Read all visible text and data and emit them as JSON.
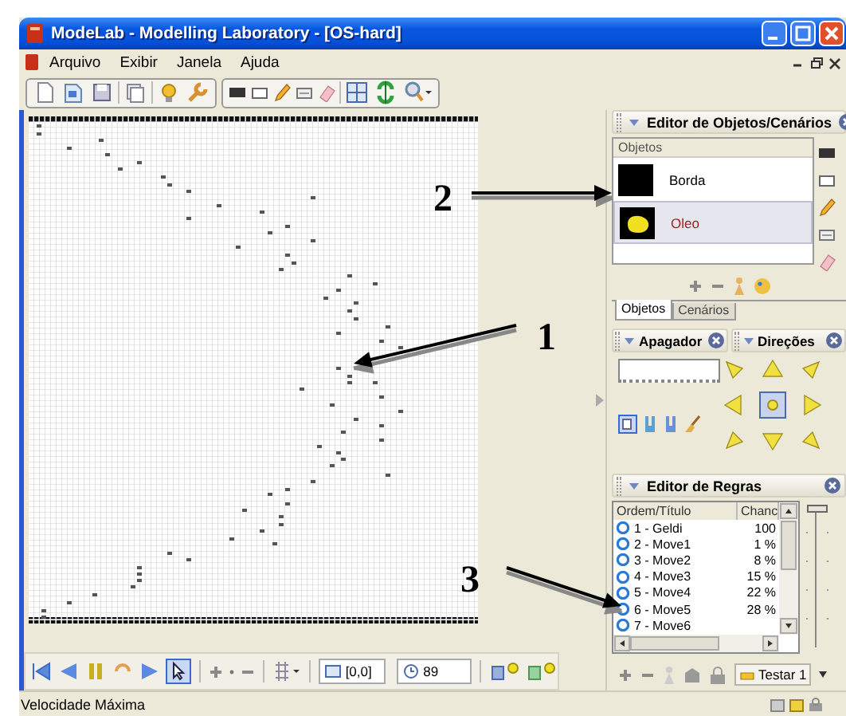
{
  "window": {
    "title": "ModeLab - Modelling Laboratory - [OS-hard]"
  },
  "menu": [
    {
      "label": "Arquivo"
    },
    {
      "label": "Exibir"
    },
    {
      "label": "Janela"
    },
    {
      "label": "Ajuda"
    }
  ],
  "objects_panel": {
    "title": "Editor de Objetos/Cenários",
    "column": "Objetos",
    "items": [
      {
        "name": "Borda",
        "color": "#000000",
        "selected": false
      },
      {
        "name": "Oleo",
        "color": "#f0e020",
        "selected": true
      }
    ],
    "tabs": [
      {
        "label": "Objetos",
        "selected": true
      },
      {
        "label": "Cenários",
        "selected": false
      }
    ]
  },
  "eraser_panel": {
    "title": "Apagador"
  },
  "directions_panel": {
    "title": "Direções"
  },
  "rules_panel": {
    "title": "Editor de Regras",
    "columns": [
      "Ordem/Título",
      "Chanc"
    ],
    "rows": [
      {
        "title": "1 - Geldi",
        "chance": "100"
      },
      {
        "title": "2 - Move1",
        "chance": "1 %"
      },
      {
        "title": "3 - Move2",
        "chance": "8 %"
      },
      {
        "title": "4 - Move3",
        "chance": "15 %"
      },
      {
        "title": "5 - Move4",
        "chance": "22 %"
      },
      {
        "title": "6 - Move5",
        "chance": "28 %"
      },
      {
        "title": "7 - Move6"
      }
    ],
    "slider": {
      "level": 1
    },
    "test_button": "Testar 1"
  },
  "bottom_toolbar": {
    "position": "[0,0]",
    "time": "89"
  },
  "status_bar": "Velocidade Máxima",
  "annotations": [
    {
      "label": "1"
    },
    {
      "label": "2"
    },
    {
      "label": "3"
    }
  ]
}
